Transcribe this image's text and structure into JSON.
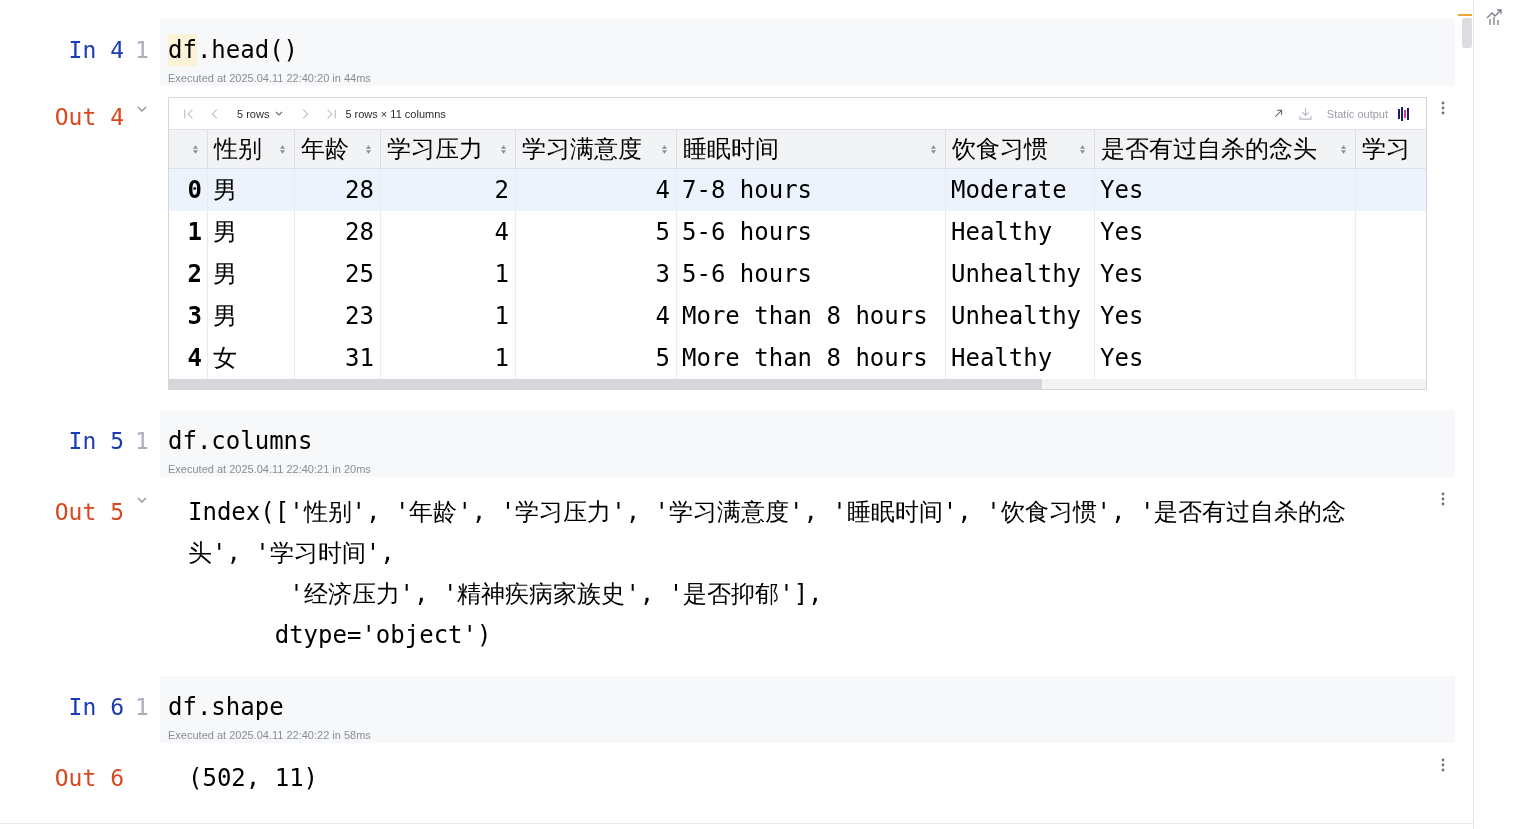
{
  "cells": [
    {
      "input": {
        "prompt": "In 4",
        "line_number": "1",
        "code": [
          {
            "text": "df",
            "highlighted": true
          },
          {
            "text": ".head()",
            "highlighted": false
          }
        ],
        "executed": "Executed at 2025.04.11 22:40:20 in 44ms"
      },
      "output": {
        "kind": "table",
        "prompt": "Out 4",
        "collapsible": true,
        "toolbar": {
          "left": [
            {
              "kind": "first",
              "disabled": true
            },
            {
              "kind": "previous",
              "disabled": true
            },
            {
              "kind": "page_size",
              "label": "5 rows"
            },
            {
              "kind": "next",
              "disabled": true
            },
            {
              "kind": "last",
              "disabled": true
            },
            {
              "kind": "summary",
              "text": "5 rows × 11 columns"
            }
          ],
          "right": [
            {
              "kind": "open",
              "disabled": false
            },
            {
              "kind": "download",
              "disabled": true
            },
            {
              "kind": "mode",
              "label": "Static output"
            },
            {
              "kind": "mode_icon"
            }
          ]
        },
        "columns": [
          {
            "label": "性别",
            "kind": "text",
            "cut_off": false
          },
          {
            "label": "年龄",
            "kind": "number",
            "cut_off": false
          },
          {
            "label": "学习压力",
            "kind": "number",
            "cut_off": false
          },
          {
            "label": "学习满意度",
            "kind": "number",
            "cut_off": false
          },
          {
            "label": "睡眠时间",
            "kind": "text",
            "cut_off": false
          },
          {
            "label": "饮食习惯",
            "kind": "text",
            "cut_off": false
          },
          {
            "label": "是否有过自杀的念头",
            "kind": "text",
            "cut_off": false
          },
          {
            "label": "学习",
            "cut_off": true
          }
        ],
        "rows": [
          {
            "index": "0",
            "selected": true,
            "cells": [
              "男",
              "28",
              "2",
              "4",
              "7-8 hours",
              "Moderate",
              "Yes"
            ]
          },
          {
            "index": "1",
            "selected": false,
            "cells": [
              "男",
              "28",
              "4",
              "5",
              "5-6 hours",
              "Healthy",
              "Yes"
            ]
          },
          {
            "index": "2",
            "selected": false,
            "cells": [
              "男",
              "25",
              "1",
              "3",
              "5-6 hours",
              "Unhealthy",
              "Yes"
            ]
          },
          {
            "index": "3",
            "selected": false,
            "cells": [
              "男",
              "23",
              "1",
              "4",
              "More than 8 hours",
              "Unhealthy",
              "Yes"
            ]
          },
          {
            "index": "4",
            "selected": false,
            "cells": [
              "女",
              "31",
              "1",
              "5",
              "More than 8 hours",
              "Healthy",
              "Yes"
            ]
          }
        ]
      }
    },
    {
      "input": {
        "prompt": "In 5",
        "line_number": "1",
        "code": [
          {
            "text": "df.columns",
            "highlighted": false
          }
        ],
        "executed": "Executed at 2025.04.11 22:40:21 in 20ms"
      },
      "output": {
        "kind": "text",
        "prompt": "Out 5",
        "collapsible": true,
        "lines": [
          "Index(['性别', '年龄', '学习压力', '学习满意度', '睡眠时间', '饮食习惯', '是否有过自杀的念",
          "头', '学习时间',",
          "       '经济压力', '精神疾病家族史', '是否抑郁'],",
          "      dtype='object')"
        ]
      }
    },
    {
      "input": {
        "prompt": "In 6",
        "line_number": "1",
        "code": [
          {
            "text": "df.shape",
            "highlighted": false
          }
        ],
        "executed": "Executed at 2025.04.11 22:40:22 in 58ms"
      },
      "output": {
        "kind": "text",
        "prompt": "Out 6",
        "collapsible": false,
        "lines": [
          "(502, 11)"
        ]
      }
    }
  ]
}
